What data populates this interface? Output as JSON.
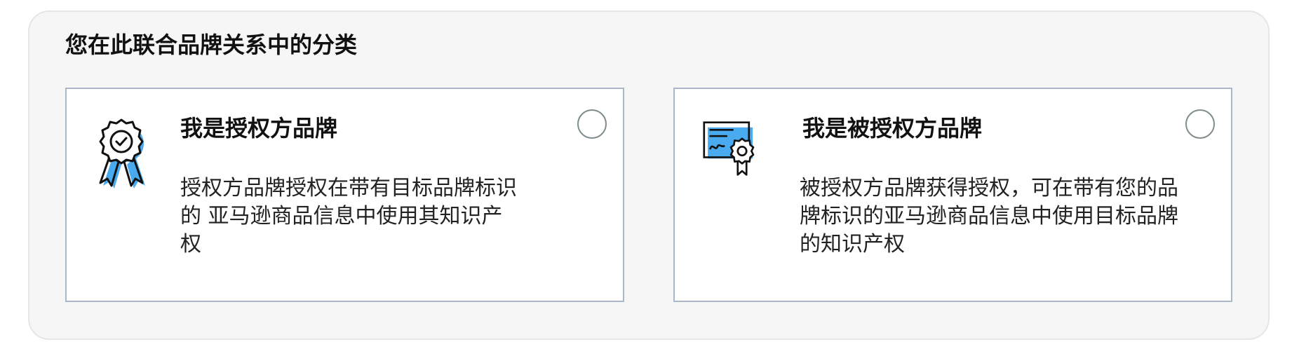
{
  "section": {
    "title": "您在此联合品牌关系中的分类"
  },
  "options": [
    {
      "title": "我是授权方品牌",
      "description": "授权方品牌授权在带有目标品牌标识的 亚马逊商品信息中使用其知识产权",
      "icon": "award-ribbon-icon",
      "selected": false
    },
    {
      "title": "我是被授权方品牌",
      "description": "被授权方品牌获得授权，可在带有您的品牌标识的亚马逊商品信息中使用目标品牌的知识产权",
      "icon": "certificate-icon",
      "selected": false
    }
  ],
  "colors": {
    "accent": "#4aaaf0",
    "border": "#a9b7c9",
    "panel_bg": "#f6f6f6",
    "radio_border": "#7f8c8d"
  }
}
